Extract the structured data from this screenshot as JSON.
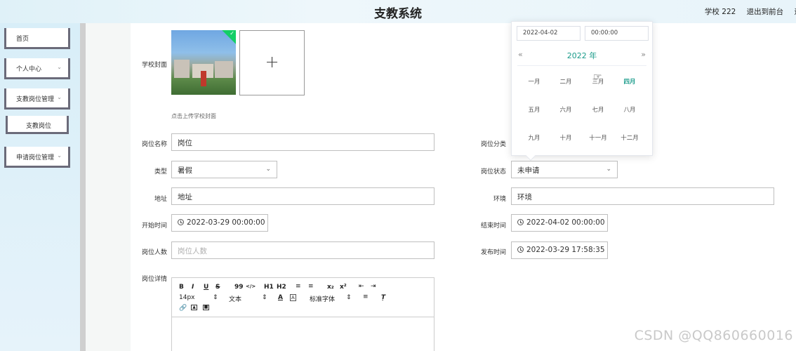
{
  "header": {
    "title": "支教系统",
    "right_items": [
      "学校 222",
      "退出到前台",
      "退"
    ]
  },
  "sidebar": {
    "items": [
      {
        "label": "首页",
        "expandable": false
      },
      {
        "label": "个人中心",
        "expandable": true
      },
      {
        "label": "支教岗位管理",
        "expandable": true
      },
      {
        "label": "支教岗位",
        "expandable": false,
        "sub": true
      },
      {
        "label": "申请岗位管理",
        "expandable": true
      }
    ]
  },
  "form": {
    "cover_label": "学校封面",
    "cover_hint": "点击上传学校封面",
    "uploader_symbol": "+",
    "position_name_label": "岗位名称",
    "position_name_value": "岗位",
    "category_label": "岗位分类",
    "type_label": "类型",
    "type_value": "暑假",
    "status_label": "岗位状态",
    "status_value": "未申请",
    "address_label": "地址",
    "address_value": "地址",
    "environment_label": "环境",
    "environment_value": "环境",
    "start_label": "开始时间",
    "start_value": "2022-03-29 00:00:00",
    "end_label": "结束时间",
    "end_value": "2022-04-02 00:00:00",
    "count_label": "岗位人数",
    "count_placeholder": "岗位人数",
    "publish_label": "发布时间",
    "publish_value": "2022-03-29 17:58:35",
    "details_label": "岗位详情"
  },
  "editor": {
    "font_size": "14px",
    "text_style": "文本",
    "font_family": "标准字体",
    "buttons_row1": [
      "B",
      "I",
      "U",
      "S",
      "99",
      "</>",
      "H1",
      "H2",
      "ol",
      "ul",
      "x₂",
      "x²",
      "outdent",
      "indent"
    ],
    "icons": [
      "bold-icon",
      "italic-icon",
      "underline-icon",
      "strike-icon",
      "quote-icon",
      "code-icon",
      "h1-icon",
      "h2-icon",
      "ordered-list-icon",
      "bullet-list-icon",
      "subscript-icon",
      "superscript-icon",
      "outdent-icon",
      "indent-icon",
      "font-color-icon",
      "background-icon",
      "align-icon",
      "clear-format-icon",
      "link-icon",
      "image-icon",
      "video-icon"
    ]
  },
  "datepicker": {
    "date_input": "2022-04-02",
    "time_input": "00:00:00",
    "year_label": "2022 年",
    "prev": "«",
    "next": "»",
    "months": [
      "一月",
      "二月",
      "三月",
      "四月",
      "五月",
      "六月",
      "七月",
      "八月",
      "九月",
      "十月",
      "十一月",
      "十二月"
    ],
    "current_month": "四月"
  },
  "watermark": "CSDN @QQ860660016",
  "colors": {
    "accent": "#1a9b8a",
    "badge": "#13ce66",
    "sidebar_border": "#6b6b7a"
  }
}
